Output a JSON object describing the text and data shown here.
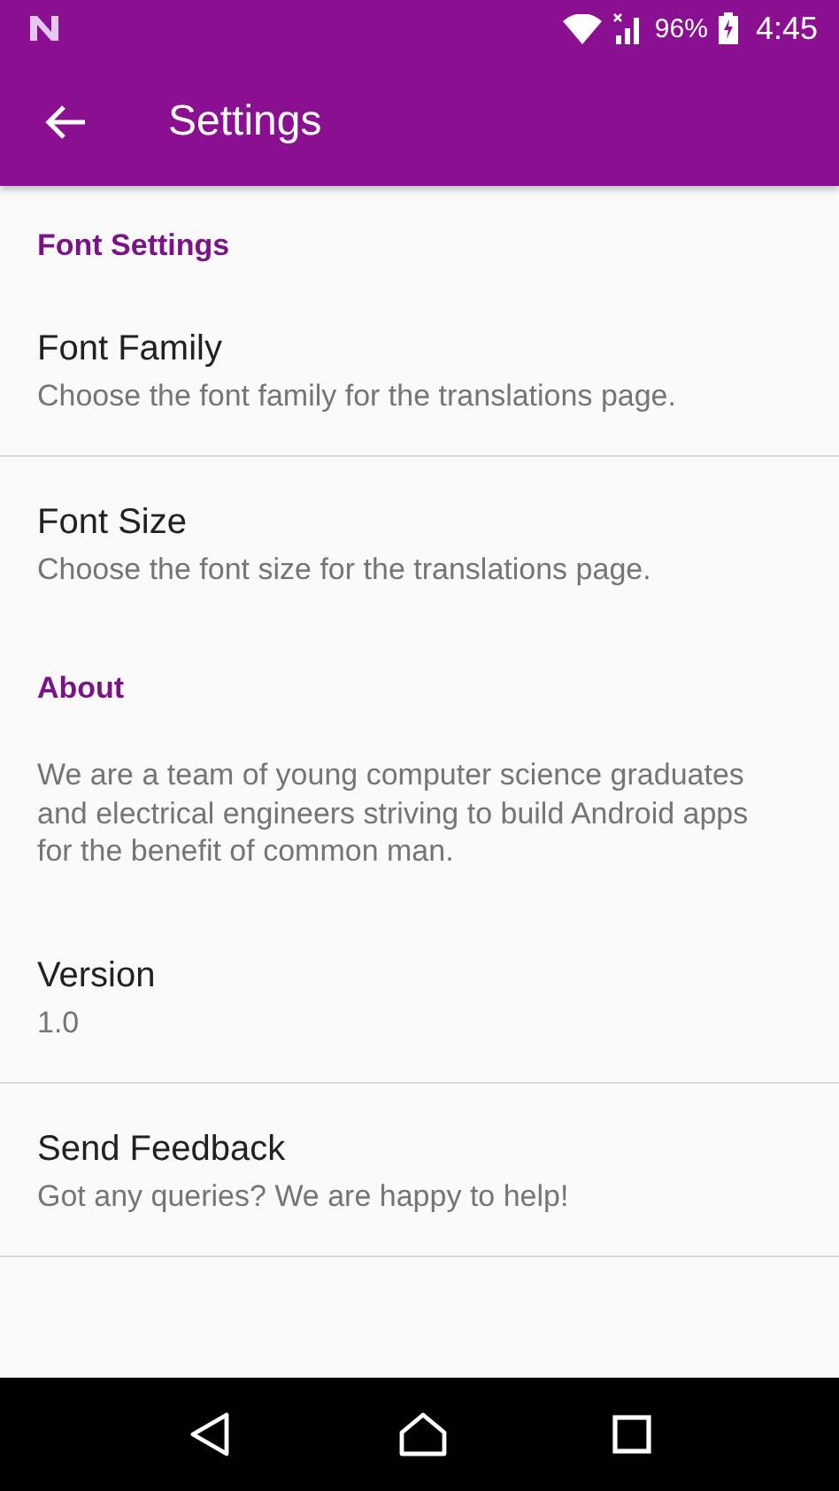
{
  "status_bar": {
    "battery": "96%",
    "time": "4:45"
  },
  "toolbar": {
    "title": "Settings"
  },
  "items": [
    {
      "kind": "header",
      "title": "Font Settings"
    },
    {
      "kind": "pref",
      "title": "Font Family",
      "summary": "Choose the font family for the translations page.",
      "divider": true
    },
    {
      "kind": "pref",
      "title": "Font Size",
      "summary": "Choose the font size for the translations page.",
      "divider": false
    },
    {
      "kind": "header",
      "title": "About"
    },
    {
      "kind": "text",
      "text": "We are a team of young computer science graduates and electrical engineers striving to build Android apps for the benefit of common man."
    },
    {
      "kind": "pref",
      "title": "Version",
      "summary": "1.0",
      "divider": true
    },
    {
      "kind": "pref",
      "title": "Send Feedback",
      "summary": "Got any queries? We are happy to help!",
      "divider": true
    }
  ]
}
